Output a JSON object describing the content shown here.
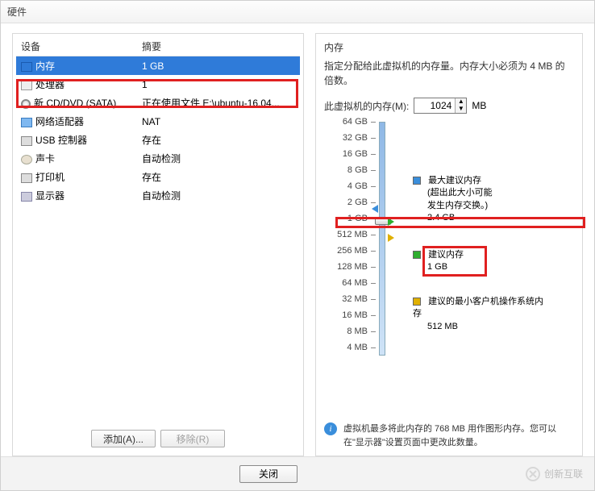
{
  "title": "硬件",
  "left": {
    "col_device": "设备",
    "col_summary": "摘要",
    "rows": [
      {
        "name": "内存",
        "summary": "1 GB",
        "iconcls": "icon-mem",
        "icon": "memory-icon",
        "selected": true
      },
      {
        "name": "处理器",
        "summary": "1",
        "iconcls": "icon-cpu",
        "icon": "cpu-icon"
      },
      {
        "name": "新 CD/DVD (SATA)",
        "summary": "正在使用文件 E:\\ubuntu-16.04...",
        "iconcls": "icon-cd",
        "icon": "cd-icon"
      },
      {
        "name": "网络适配器",
        "summary": "NAT",
        "iconcls": "icon-net",
        "icon": "network-icon"
      },
      {
        "name": "USB 控制器",
        "summary": "存在",
        "iconcls": "icon-usb",
        "icon": "usb-icon"
      },
      {
        "name": "声卡",
        "summary": "自动检测",
        "iconcls": "icon-sound",
        "icon": "sound-icon"
      },
      {
        "name": "打印机",
        "summary": "存在",
        "iconcls": "icon-print",
        "icon": "printer-icon"
      },
      {
        "name": "显示器",
        "summary": "自动检测",
        "iconcls": "icon-disp",
        "icon": "display-icon"
      }
    ],
    "add_btn": "添加(A)...",
    "remove_btn": "移除(R)"
  },
  "right": {
    "section_title": "内存",
    "desc": "指定分配给此虚拟机的内存量。内存大小必须为 4 MB 的倍数。",
    "mem_label": "此虚拟机的内存(M):",
    "mem_value": "1024",
    "mem_unit": "MB",
    "ticks": [
      "64 GB",
      "32 GB",
      "16 GB",
      "8 GB",
      "4 GB",
      "2 GB",
      "1 GB",
      "512 MB",
      "256 MB",
      "128 MB",
      "64 MB",
      "32 MB",
      "16 MB",
      "8 MB",
      "4 MB"
    ],
    "legend_max_title": "最大建议内存",
    "legend_max_note1": "(超出此大小可能",
    "legend_max_note2": "发生内存交换。)",
    "legend_max_val": "2.4 GB",
    "legend_rec_title": "建议内存",
    "legend_rec_val": "1 GB",
    "legend_min_title": "建议的最小客户机操作系统内存",
    "legend_min_val": "512 MB",
    "info": "虚拟机最多将此内存的 768 MB 用作图形内存。您可以在\"显示器\"设置页面中更改此数量。"
  },
  "close": "关闭",
  "watermark": "创新互联"
}
